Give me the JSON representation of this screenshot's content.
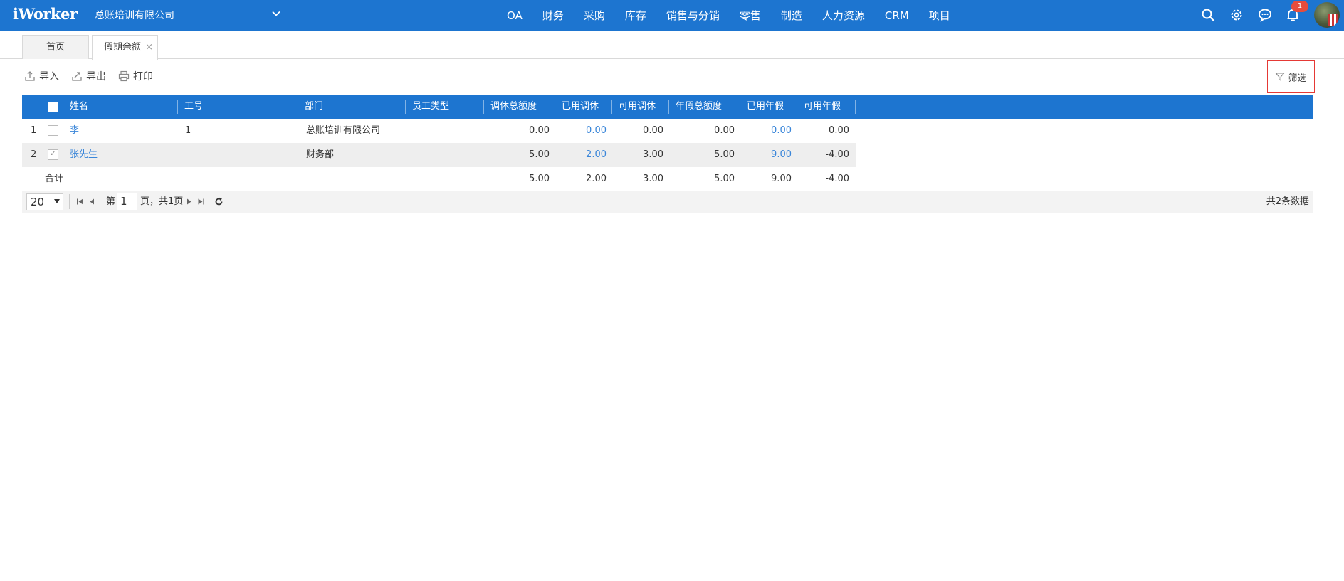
{
  "app": {
    "logo": "iWorker",
    "company": "总账培训有限公司",
    "nav": [
      "OA",
      "财务",
      "采购",
      "库存",
      "销售与分销",
      "零售",
      "制造",
      "人力资源",
      "CRM",
      "项目"
    ],
    "notification_count": "1"
  },
  "tabs": {
    "home": "首页",
    "current": "假期余额",
    "close": "×"
  },
  "toolbar": {
    "import": "导入",
    "export": "导出",
    "print": "打印",
    "filter": "筛选"
  },
  "grid": {
    "columns": {
      "name": "姓名",
      "emp_no": "工号",
      "dept": "部门",
      "emp_type": "员工类型",
      "leave_total": "调休总额度",
      "leave_used": "已用调休",
      "leave_avail": "可用调休",
      "annual_total": "年假总额度",
      "annual_used": "已用年假",
      "annual_avail": "可用年假"
    },
    "rows": [
      {
        "index": "1",
        "name": "李",
        "emp_no": "1",
        "dept": "总账培训有限公司",
        "emp_type": "",
        "leave_total": "0.00",
        "leave_used": "0.00",
        "leave_avail": "0.00",
        "annual_total": "0.00",
        "annual_used": "0.00",
        "annual_avail": "0.00"
      },
      {
        "index": "2",
        "name": "张先生",
        "emp_no": "",
        "dept": "财务部",
        "emp_type": "",
        "leave_total": "5.00",
        "leave_used": "2.00",
        "leave_avail": "3.00",
        "annual_total": "5.00",
        "annual_used": "9.00",
        "annual_avail": "-4.00"
      }
    ],
    "totals": {
      "label": "合计",
      "leave_total": "5.00",
      "leave_used": "2.00",
      "leave_avail": "3.00",
      "annual_total": "5.00",
      "annual_used": "9.00",
      "annual_avail": "-4.00"
    }
  },
  "pager": {
    "page_size": "20",
    "page_prefix": "第",
    "page": "1",
    "page_suffix": "页，共1页",
    "total": "共2条数据"
  }
}
